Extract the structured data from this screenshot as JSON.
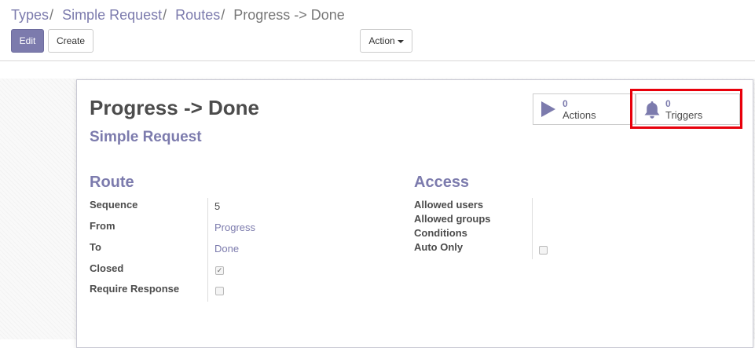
{
  "breadcrumb": {
    "items": [
      "Types",
      "Simple Request",
      "Routes"
    ],
    "separator": "/",
    "current": "Progress -> Done"
  },
  "toolbar": {
    "edit_label": "Edit",
    "create_label": "Create",
    "action_label": "Action"
  },
  "record": {
    "title": "Progress -> Done",
    "subtitle": "Simple Request"
  },
  "smart_buttons": {
    "actions": {
      "count": "0",
      "label": "Actions",
      "icon": "play-icon"
    },
    "triggers": {
      "count": "0",
      "label": "Triggers",
      "icon": "bell-icon",
      "highlighted": true
    }
  },
  "route_group": {
    "title": "Route",
    "sequence_label": "Sequence",
    "sequence_value": "5",
    "from_label": "From",
    "from_value": "Progress",
    "to_label": "To",
    "to_value": "Done",
    "closed_label": "Closed",
    "closed_checked": true,
    "require_response_label": "Require Response",
    "require_response_checked": false
  },
  "access_group": {
    "title": "Access",
    "allowed_users_label": "Allowed users",
    "allowed_groups_label": "Allowed groups",
    "conditions_label": "Conditions",
    "auto_only_label": "Auto Only",
    "auto_only_checked": false
  },
  "colors": {
    "accent": "#7c7bad",
    "text": "#4c4c4c",
    "highlight": "#e8000b"
  }
}
